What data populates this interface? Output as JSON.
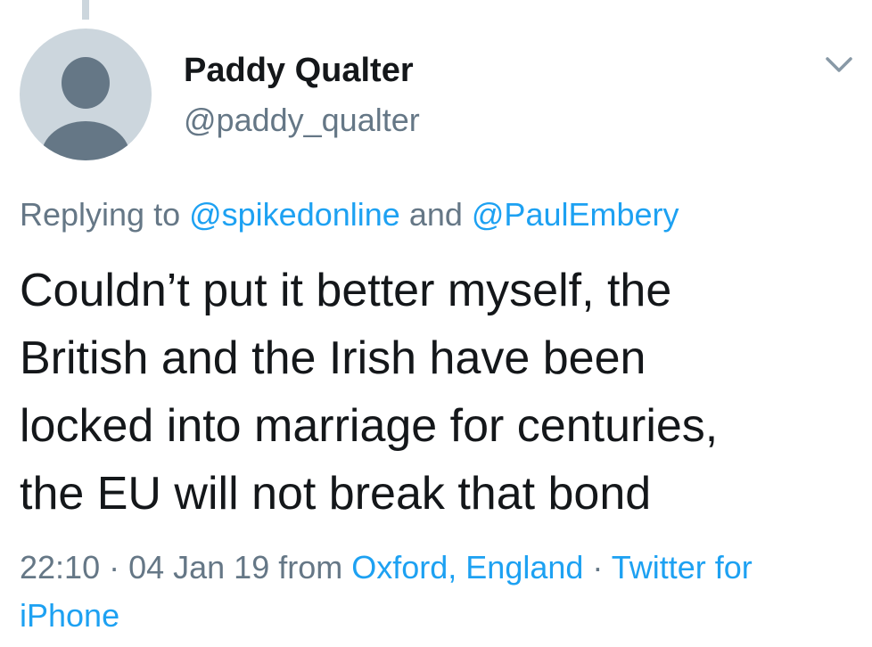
{
  "tweet": {
    "author": {
      "display_name": "Paddy Qualter",
      "handle": "@paddy_qualter",
      "avatar_icon": "default-profile-icon"
    },
    "replying_prefix": "Replying to ",
    "reply_to": [
      "@spikedonline",
      "@PaulEmbery"
    ],
    "reply_joiner": " and ",
    "text_lines": [
      "Couldn’t put it better myself, the",
      "British and the Irish have been",
      "locked into marriage for centuries,",
      "the EU will not break that bond"
    ],
    "time": "22:10",
    "date": "04 Jan 19",
    "sep": " · ",
    "from_label": " from ",
    "location": "Oxford, England",
    "client": "Twitter for iPhone"
  },
  "colors": {
    "link": "#1da1f2",
    "secondary_text": "#657786",
    "primary_text": "#14171a",
    "avatar_bg": "#ccd6dd"
  },
  "icons": {
    "menu": "chevron-down-icon"
  }
}
